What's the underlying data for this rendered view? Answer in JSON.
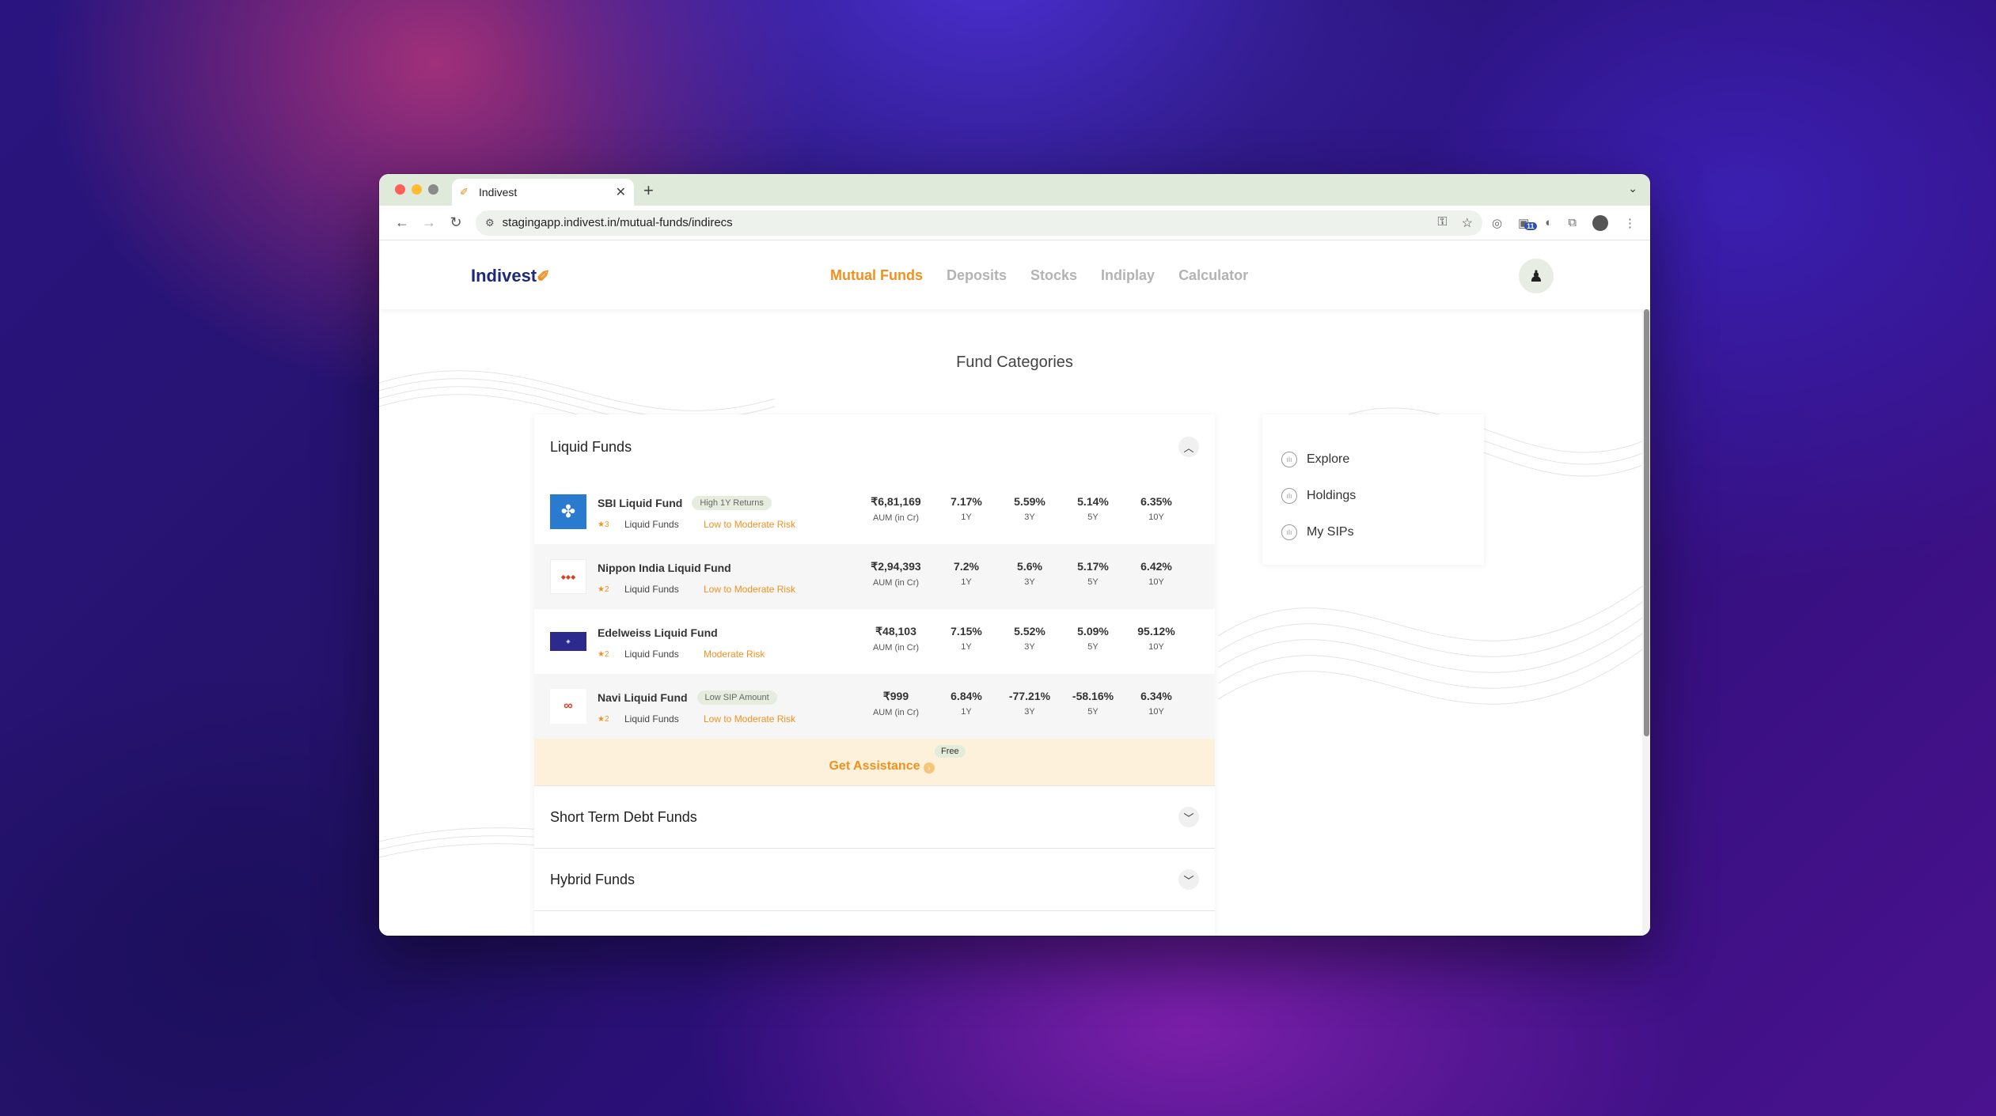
{
  "browser": {
    "tab_title": "Indivest",
    "new_tab": "+",
    "url": "stagingapp.indivest.in/mutual-funds/indirecs",
    "ext_badge": "11"
  },
  "header": {
    "logo": "Indivest",
    "nav": [
      "Mutual Funds",
      "Deposits",
      "Stocks",
      "Indiplay",
      "Calculator"
    ]
  },
  "page": {
    "title": "Fund Categories"
  },
  "categories": {
    "expanded": "Liquid Funds",
    "collapsed": [
      "Short Term Debt Funds",
      "Hybrid Funds"
    ]
  },
  "metric_labels": {
    "aum": "AUM (in Cr)",
    "y1": "1Y",
    "y3": "3Y",
    "y5": "5Y",
    "y10": "10Y"
  },
  "funds": [
    {
      "name": "SBI Liquid Fund",
      "badge": "High 1Y Returns",
      "rating": "★3",
      "category": "Liquid Funds",
      "risk": "Low to Moderate Risk",
      "aum": "₹6,81,169",
      "y1": "7.17%",
      "y3": "5.59%",
      "y5": "5.14%",
      "y10": "6.35%"
    },
    {
      "name": "Nippon India Liquid Fund",
      "badge": "",
      "rating": "★2",
      "category": "Liquid Funds",
      "risk": "Low to Moderate Risk",
      "aum": "₹2,94,393",
      "y1": "7.2%",
      "y3": "5.6%",
      "y5": "5.17%",
      "y10": "6.42%"
    },
    {
      "name": "Edelweiss Liquid Fund",
      "badge": "",
      "rating": "★2",
      "category": "Liquid Funds",
      "risk": "Moderate Risk",
      "aum": "₹48,103",
      "y1": "7.15%",
      "y3": "5.52%",
      "y5": "5.09%",
      "y10": "95.12%"
    },
    {
      "name": "Navi Liquid Fund",
      "badge": "Low SIP Amount",
      "rating": "★2",
      "category": "Liquid Funds",
      "risk": "Low to Moderate Risk",
      "aum": "₹999",
      "y1": "6.84%",
      "y3": "-77.21%",
      "y5": "-58.16%",
      "y10": "6.34%"
    }
  ],
  "assist": {
    "label": "Get Assistance",
    "free": "Free"
  },
  "side_menu": [
    "Explore",
    "Holdings",
    "My SIPs"
  ]
}
